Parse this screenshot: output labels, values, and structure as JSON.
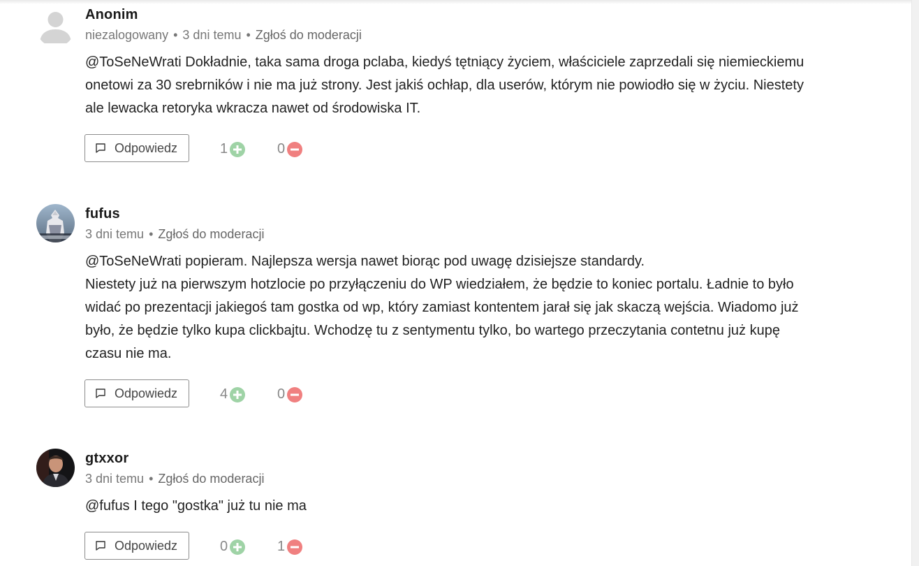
{
  "comments": [
    {
      "author": "Anonim",
      "guest_label": "niezalogowany",
      "time": "3 dni temu",
      "report": "Zgłoś do moderacji",
      "lines": [
        "@ToSeNeWrati Dokładnie, taka sama droga pclaba, kiedyś tętniący życiem, właściciele zaprzedali się niemieckiemu",
        "onetowi za 30 srebrników i nie ma już strony. Jest jakiś ochłap, dla userów, którym nie powiodło się w życiu. Niestety",
        "ale lewacka retoryka wkracza nawet od środowiska IT."
      ],
      "reply": "Odpowiedz",
      "upvotes": "1",
      "downvotes": "0",
      "avatar_icon": "default-user-avatar-icon"
    },
    {
      "author": "fufus",
      "time": "3 dni temu",
      "report": "Zgłoś do moderacji",
      "lines": [
        "@ToSeNeWrati popieram. Najlepsza wersja nawet biorąc pod uwagę dzisiejsze standardy.",
        "Niestety już na pierwszym hotzlocie po przyłączeniu do WP wiedziałem, że będzie to koniec portalu. Ładnie to było",
        "widać po prezentacji jakiegoś tam gostka od wp, który zamiast kontentem jarał się jak skaczą wejścia. Wiadomo już",
        "było, że będzie tylko kupa clickbajtu. Wchodzę tu z sentymentu tylko, bo wartego przeczytania contetnu już kupę",
        "czasu nie ma."
      ],
      "reply": "Odpowiedz",
      "upvotes": "4",
      "downvotes": "0"
    },
    {
      "author": "gtxxor",
      "time": "3 dni temu",
      "report": "Zgłoś do moderacji",
      "lines": [
        "@fufus I tego \"gostka\" już tu nie ma"
      ],
      "reply": "Odpowiedz",
      "upvotes": "0",
      "downvotes": "1"
    }
  ],
  "colors": {
    "upvote": "#9fd3a6",
    "downvote": "#f08080",
    "meta_text": "#777777",
    "border": "#8c8c8c"
  }
}
